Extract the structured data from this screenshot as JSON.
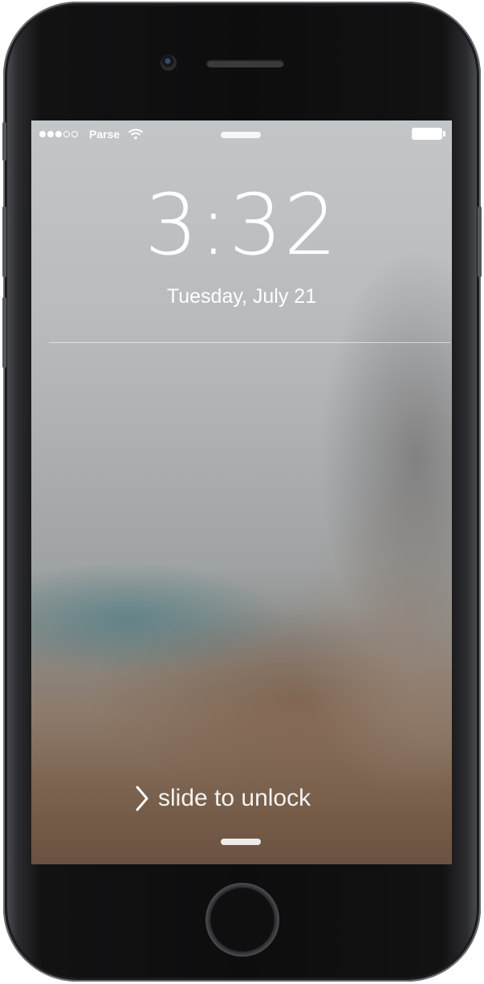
{
  "status_bar": {
    "signal_dots": [
      "filled",
      "filled",
      "filled",
      "empty",
      "empty"
    ],
    "carrier": "Parse",
    "wifi_icon": "wifi-icon",
    "battery_icon": "battery-icon"
  },
  "lock_screen": {
    "time": "3:32",
    "date": "Tuesday, July 21",
    "unlock_text": "slide to unlock",
    "unlock_icon": "chevron-right-icon"
  },
  "colors": {
    "screen_top": "#c3c6c8",
    "screen_bottom": "#6a5240",
    "text": "#ffffff",
    "bezel": "#0d0d0e"
  }
}
